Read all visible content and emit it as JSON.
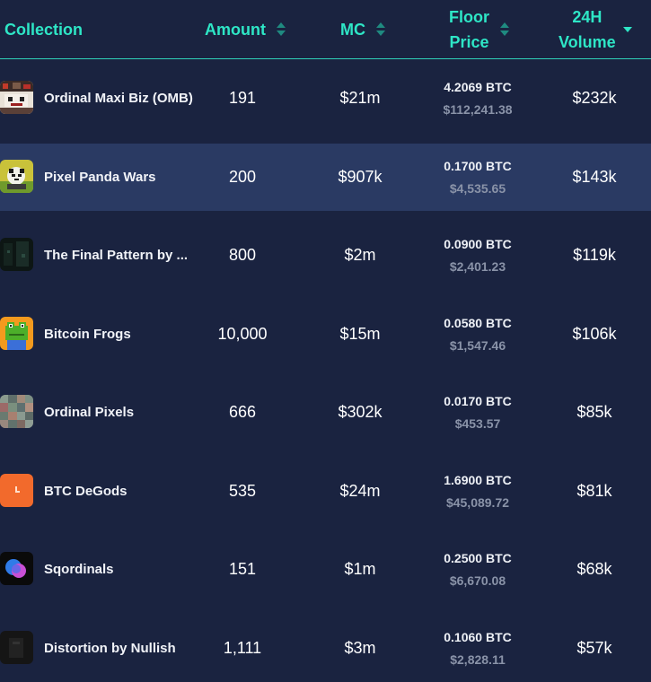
{
  "header": {
    "collection": "Collection",
    "amount": "Amount",
    "mc": "MC",
    "floor_line1": "Floor",
    "floor_line2": "Price",
    "volume_line1": "24H",
    "volume_line2": "Volume"
  },
  "rows": [
    {
      "name": "Ordinal Maxi Biz (OMB)",
      "amount": "191",
      "mc": "$21m",
      "floor_btc": "4.2069 BTC",
      "floor_usd": "$112,241.38",
      "volume": "$232k",
      "thumb": "omb-thumbnail"
    },
    {
      "name": "Pixel Panda Wars",
      "amount": "200",
      "mc": "$907k",
      "floor_btc": "0.1700 BTC",
      "floor_usd": "$4,535.65",
      "volume": "$143k",
      "thumb": "panda-thumbnail"
    },
    {
      "name": "The Final Pattern by ...",
      "amount": "800",
      "mc": "$2m",
      "floor_btc": "0.0900 BTC",
      "floor_usd": "$2,401.23",
      "volume": "$119k",
      "thumb": "pattern-thumbnail"
    },
    {
      "name": "Bitcoin Frogs",
      "amount": "10,000",
      "mc": "$15m",
      "floor_btc": "0.0580 BTC",
      "floor_usd": "$1,547.46",
      "volume": "$106k",
      "thumb": "frog-thumbnail"
    },
    {
      "name": "Ordinal Pixels",
      "amount": "666",
      "mc": "$302k",
      "floor_btc": "0.0170 BTC",
      "floor_usd": "$453.57",
      "volume": "$85k",
      "thumb": "pixels-thumbnail"
    },
    {
      "name": "BTC DeGods",
      "amount": "535",
      "mc": "$24m",
      "floor_btc": "1.6900 BTC",
      "floor_usd": "$45,089.72",
      "volume": "$81k",
      "thumb": "degods-thumbnail"
    },
    {
      "name": "Sqordinals",
      "amount": "151",
      "mc": "$1m",
      "floor_btc": "0.2500 BTC",
      "floor_usd": "$6,670.08",
      "volume": "$68k",
      "thumb": "sqordinals-thumbnail"
    },
    {
      "name": "Distortion by Nullish",
      "amount": "1,111",
      "mc": "$3m",
      "floor_btc": "0.1060 BTC",
      "floor_usd": "$2,828.11",
      "volume": "$57k",
      "thumb": "distortion-thumbnail"
    }
  ],
  "colors": {
    "background": "#1a2340",
    "header_accent": "#2ee6c6",
    "row_highlight": "#2a3a63",
    "muted_text": "#8a93a8"
  }
}
